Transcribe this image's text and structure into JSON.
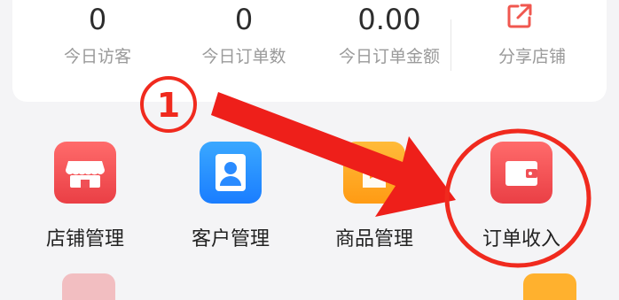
{
  "stats": [
    {
      "value": "0",
      "label": "今日访客"
    },
    {
      "value": "0",
      "label": "今日订单数"
    },
    {
      "value": "0.00",
      "label": "今日订单金额"
    }
  ],
  "share": {
    "label": "分享店铺",
    "icon": "share-icon"
  },
  "menu": [
    {
      "label": "店铺管理",
      "icon": "store-icon"
    },
    {
      "label": "客户管理",
      "icon": "customer-icon"
    },
    {
      "label": "商品管理",
      "icon": "goods-icon"
    },
    {
      "label": "订单收入",
      "icon": "wallet-icon"
    }
  ],
  "annotation": {
    "step_number": "1"
  },
  "colors": {
    "accent_red": "#ea3f45",
    "annotation_red": "#f02a1e",
    "blue": "#1a7dff",
    "orange": "#ff9b14"
  }
}
